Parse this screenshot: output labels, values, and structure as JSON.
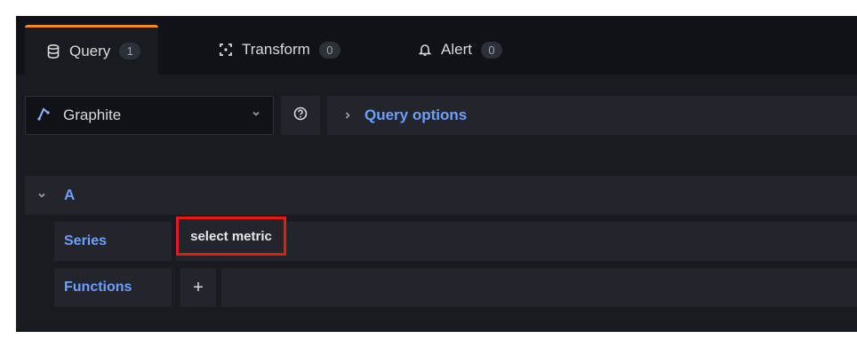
{
  "tabs": [
    {
      "label": "Query",
      "count": "1",
      "icon": "database-icon"
    },
    {
      "label": "Transform",
      "count": "0",
      "icon": "transform-icon"
    },
    {
      "label": "Alert",
      "count": "0",
      "icon": "bell-icon"
    }
  ],
  "datasource": {
    "name": "Graphite",
    "icon": "graphite-icon"
  },
  "query_options_label": "Query options",
  "query": {
    "ref_id": "A",
    "series_label": "Series",
    "series_value": "select metric",
    "functions_label": "Functions",
    "add_label": "+"
  },
  "colors": {
    "accent": "#f28a1f",
    "link": "#6e9fff",
    "highlight": "#e31b1b"
  }
}
